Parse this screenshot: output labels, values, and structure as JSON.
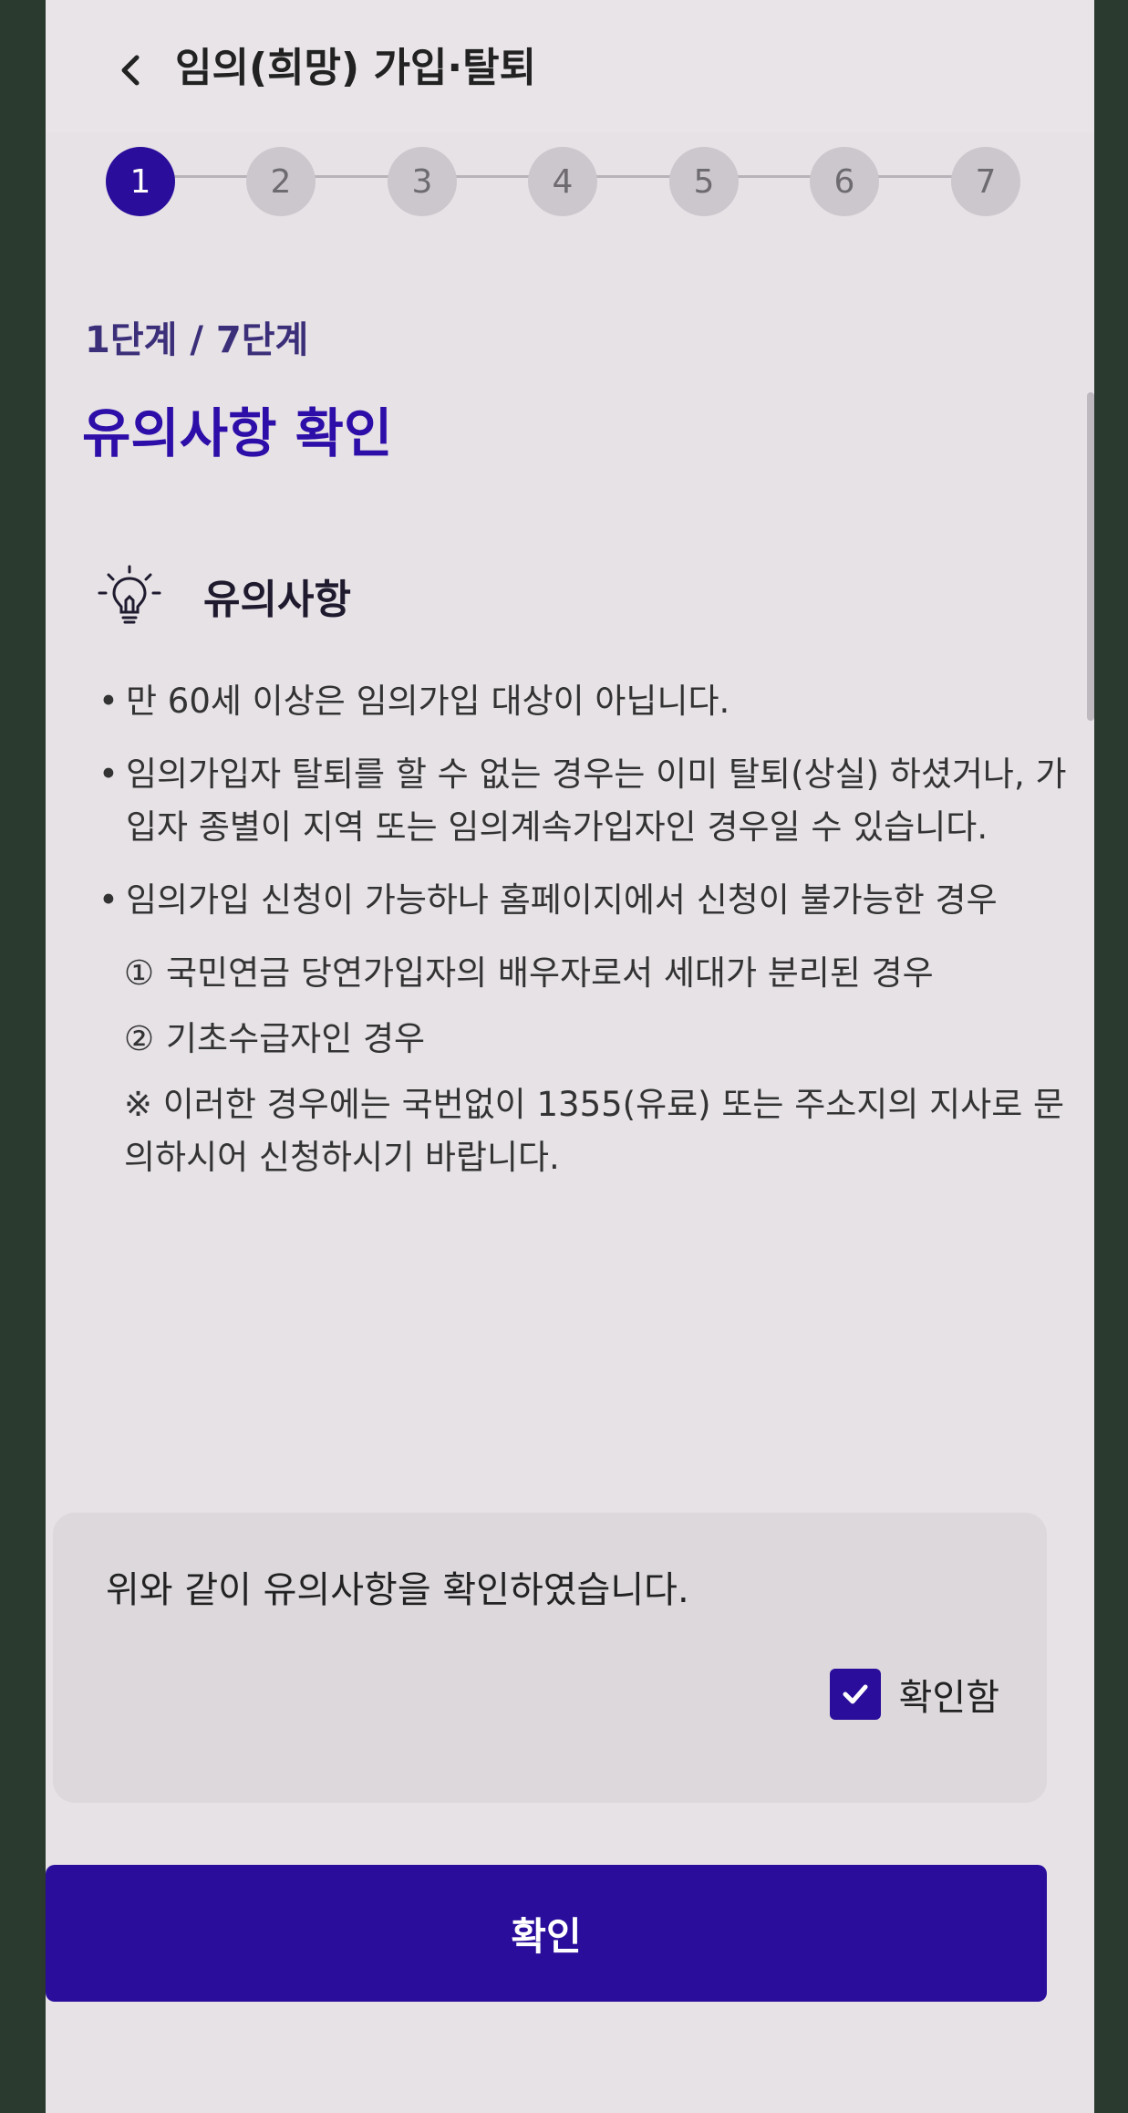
{
  "header": {
    "title": "임의(희망) 가입·탈퇴"
  },
  "stepper": {
    "steps": [
      "1",
      "2",
      "3",
      "4",
      "5",
      "6",
      "7"
    ],
    "active": 1
  },
  "page": {
    "step_count": "1단계 / 7단계",
    "title": "유의사항 확인"
  },
  "notice": {
    "heading": "유의사항",
    "icon": "lightbulb-icon",
    "items": [
      "만 60세 이상은 임의가입 대상이 아닙니다.",
      "임의가입자 탈퇴를 할 수 없는 경우는 이미 탈퇴(상실) 하셨거나, 가입자 종별이 지역 또는 임의계속가입자인 경우일 수 있습니다.",
      "임의가입 신청이 가능하나 홈페이지에서 신청이 불가능한 경우"
    ],
    "sub_items": [
      {
        "num": "①",
        "text": "국민연금 당연가입자의 배우자로서 세대가 분리된 경우"
      },
      {
        "num": "②",
        "text": "기초수급자인 경우"
      }
    ],
    "footnote": "※ 이러한 경우에는 국번없이 1355(유료) 또는 주소지의 지사로 문의하시어 신청하시기 바랍니다."
  },
  "confirm": {
    "text": "위와 같이 유의사항을 확인하였습니다.",
    "checkbox_label": "확인함",
    "checked": true
  },
  "button": {
    "label": "확인"
  },
  "colors": {
    "accent": "#2a0d9b",
    "title": "#2e0ea8",
    "background": "#e6e2e6"
  }
}
